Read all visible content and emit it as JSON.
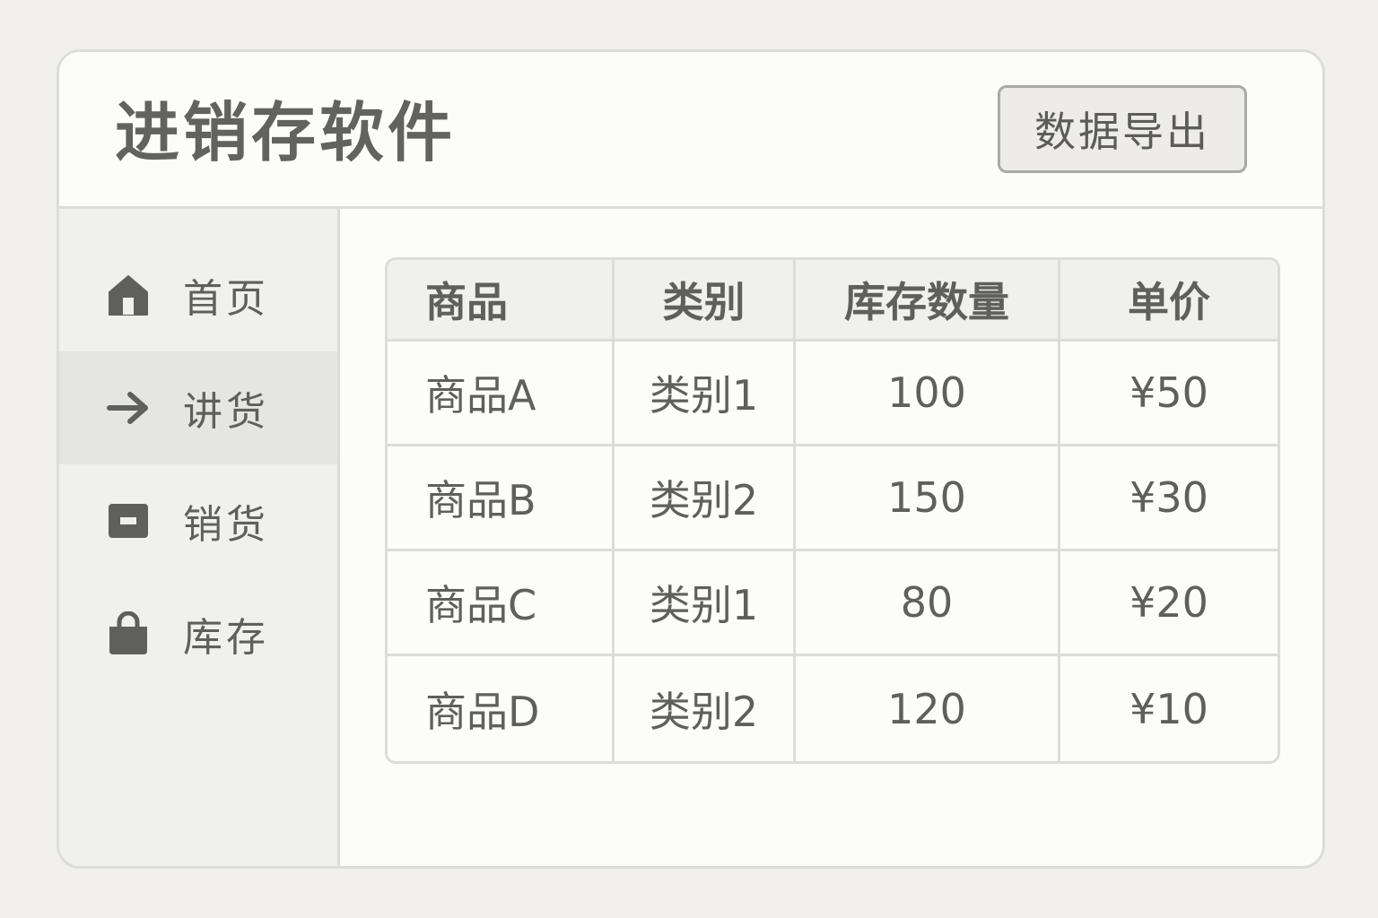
{
  "header": {
    "title": "进销存软件",
    "export_label": "数据导出"
  },
  "sidebar": {
    "items": [
      {
        "label": "首页",
        "icon": "home-icon",
        "active": false
      },
      {
        "label": "讲货",
        "icon": "arrow-right-icon",
        "active": true
      },
      {
        "label": "销货",
        "icon": "box-icon",
        "active": false
      },
      {
        "label": "库存",
        "icon": "bag-icon",
        "active": false
      }
    ]
  },
  "table": {
    "columns": [
      "商品",
      "类别",
      "库存数量",
      "单价"
    ],
    "rows": [
      {
        "name": "商品A",
        "category": "类别1",
        "qty": "100",
        "price": "¥50"
      },
      {
        "name": "商品B",
        "category": "类别2",
        "qty": "150",
        "price": "¥30"
      },
      {
        "name": "商品C",
        "category": "类别1",
        "qty": "80",
        "price": "¥20"
      },
      {
        "name": "商品D",
        "category": "类别2",
        "qty": "120",
        "price": "¥10"
      }
    ]
  },
  "colors": {
    "background": "#f1f0ec",
    "panel": "#fcfcfa",
    "sidebar": "#f0f0ed",
    "active_item": "#e5e5e2",
    "border": "#dcdcd8",
    "text": "#5f5f5c"
  }
}
